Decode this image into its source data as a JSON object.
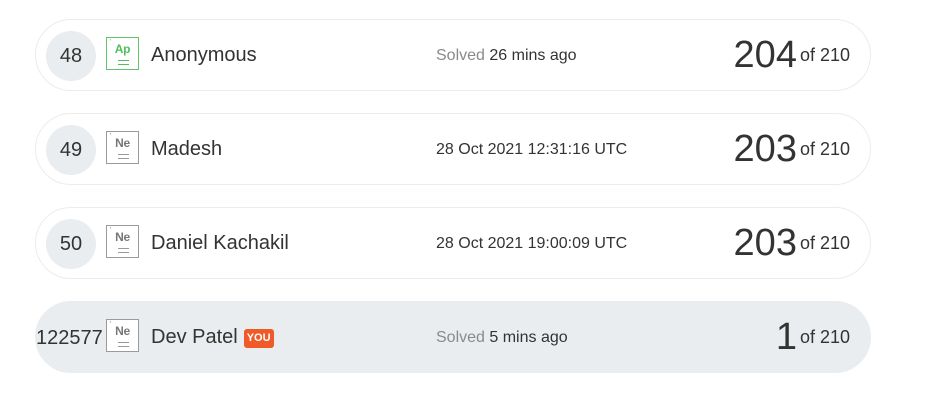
{
  "leaderboard": [
    {
      "rank": "48",
      "badge": {
        "symbol": "Ap",
        "number": "'",
        "color": "#4fbf5b"
      },
      "name": "Anonymous",
      "time_label": "Solved",
      "time_value": "26 mins ago",
      "score": "204",
      "total": "of 210",
      "is_you": false
    },
    {
      "rank": "49",
      "badge": {
        "symbol": "Ne",
        "number": "'",
        "color": "#777777"
      },
      "name": "Madesh",
      "time_label": "",
      "time_value": "28 Oct 2021 12:31:16 UTC",
      "score": "203",
      "total": "of 210",
      "is_you": false
    },
    {
      "rank": "50",
      "badge": {
        "symbol": "Ne",
        "number": "'",
        "color": "#777777"
      },
      "name": "Daniel Kachakil",
      "time_label": "",
      "time_value": "28 Oct 2021 19:00:09 UTC",
      "score": "203",
      "total": "of 210",
      "is_you": false
    },
    {
      "rank": "122577",
      "badge": {
        "symbol": "Ne",
        "number": "'",
        "color": "#777777"
      },
      "name": "Dev Patel",
      "you_tag": "YOU",
      "time_label": "Solved",
      "time_value": "5 mins ago",
      "score": "1",
      "total": "of 210",
      "is_you": true
    }
  ],
  "colors": {
    "you_tag": "#f05a28",
    "you_row_bg": "#e9edef",
    "badge_green": "#4fbf5b"
  }
}
